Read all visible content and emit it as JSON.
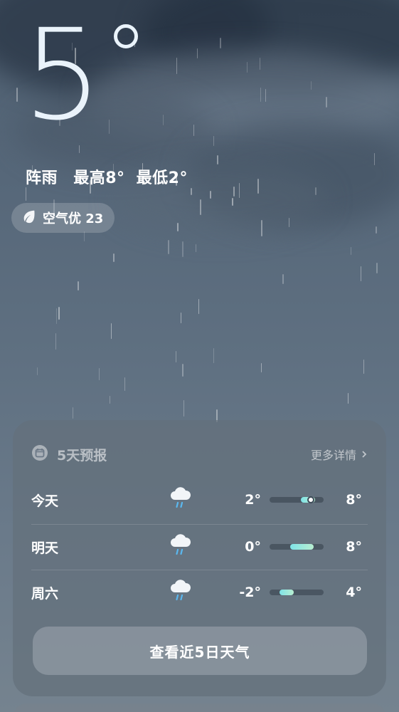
{
  "current": {
    "temperature": "5",
    "condition": "阵雨",
    "high": "最高8°",
    "low": "最低2°"
  },
  "aqi": {
    "label": "空气优 23",
    "icon": "leaf-icon"
  },
  "forecast": {
    "title": "5天预报",
    "icon": "calendar-icon",
    "more_label": "更多详情",
    "more_icon": "chevron-right-icon",
    "days": [
      {
        "day": "今天",
        "icon": "rain-cloud-icon",
        "low": "2°",
        "high": "8°",
        "low_value": 2,
        "high_value": 8,
        "current_value": 5
      },
      {
        "day": "明天",
        "icon": "rain-cloud-icon",
        "low": "0°",
        "high": "8°",
        "low_value": 0,
        "high_value": 8
      },
      {
        "day": "周六",
        "icon": "rain-cloud-icon",
        "low": "-2°",
        "high": "4°",
        "low_value": -2,
        "high_value": 4
      }
    ],
    "range_min": -2,
    "range_max": 8,
    "button_label": "查看近5日天气"
  },
  "colors": {
    "bar_start": "#7fe3e8",
    "bar_end": "#b8eed0",
    "rain_drop": "#5ab8f0"
  }
}
